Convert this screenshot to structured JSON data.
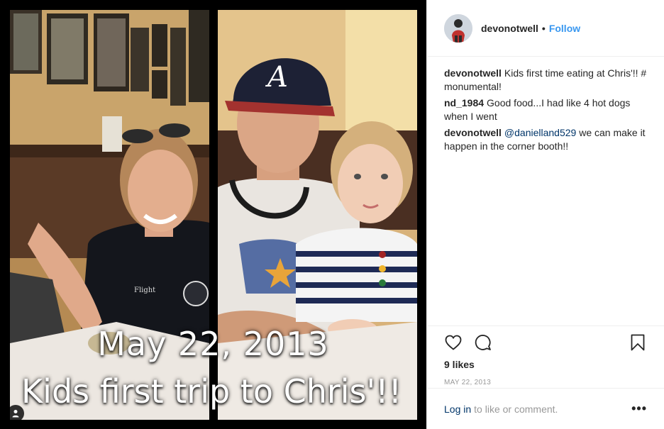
{
  "post": {
    "photo": {
      "caption_line1": "May 22, 2013",
      "caption_line2": "Kids first trip to Chris'!!"
    },
    "header": {
      "username": "devonotwell",
      "separator": "•",
      "follow_label": "Follow"
    },
    "comments": [
      {
        "user": "devonotwell",
        "text": "Kids first time eating at Chris'!! # monumental!"
      },
      {
        "user": "nd_1984",
        "text": "Good food...I had like 4 hot dogs when I went"
      },
      {
        "user": "devonotwell",
        "mention": "@danielland529",
        "text": " we can make it happen in the corner booth!!"
      }
    ],
    "actions": {
      "like_icon": "heart-icon",
      "comment_icon": "comment-bubble-icon",
      "save_icon": "bookmark-icon"
    },
    "likes_text": "9 likes",
    "date_text": "MAY 22, 2013",
    "login_bar": {
      "login_label": "Log in",
      "suffix_text": "to like or comment.",
      "more_label": "•••"
    },
    "colors": {
      "accent": "#3897f0",
      "link_dark": "#003569",
      "muted": "#999999",
      "text": "#262626"
    }
  }
}
